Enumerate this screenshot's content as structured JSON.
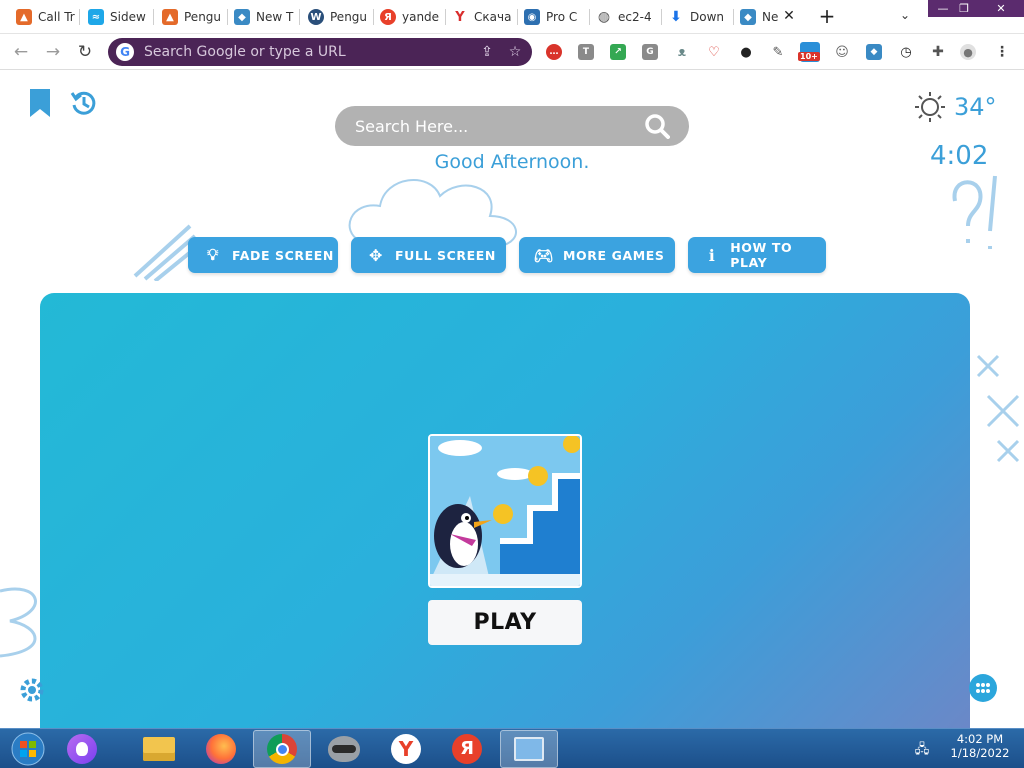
{
  "browser": {
    "tabs": [
      {
        "label": "Call Tr",
        "color": "#e46a2a"
      },
      {
        "label": "Sidew",
        "color": "#1ea7e8"
      },
      {
        "label": "Pengu",
        "color": "#e46a2a"
      },
      {
        "label": "New T",
        "color": "#3a8ac4"
      },
      {
        "label": "Pengu",
        "color": "#2a4f7a"
      },
      {
        "label": "yande",
        "color": "#e8402a"
      },
      {
        "label": "Скача",
        "color": "#d92d2d"
      },
      {
        "label": "Pro C",
        "color": "#2d6fb0"
      },
      {
        "label": "ec2-4",
        "color": "#555555"
      },
      {
        "label": "Down",
        "color": "#1a73e8"
      },
      {
        "label": "Ne",
        "color": "#3a8ac4"
      }
    ],
    "omnibox_placeholder": "Search Google or type a URL",
    "extension_badge": "10+"
  },
  "page": {
    "search_placeholder": "Search Here...",
    "greeting": "Good Afternoon.",
    "temperature": "34°",
    "clock": "4:02",
    "buttons": {
      "fade": "FADE SCREEN",
      "full": "FULL SCREEN",
      "more": "MORE GAMES",
      "howto": "HOW TO PLAY"
    },
    "play_label": "PLAY"
  },
  "taskbar": {
    "time": "4:02 PM",
    "date": "1/18/2022"
  },
  "colors": {
    "accent": "#3b9fd8",
    "omnibox": "#4b2456",
    "game_gradient_start": "#23b9d6",
    "game_gradient_end": "#6f86c6"
  }
}
